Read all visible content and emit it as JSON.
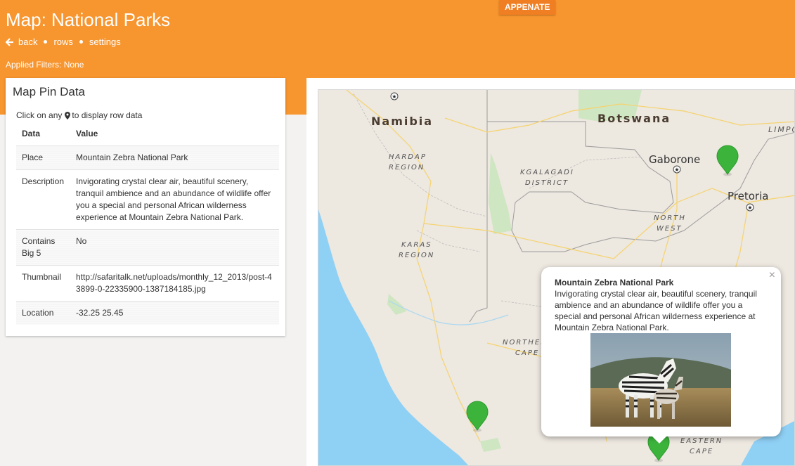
{
  "header": {
    "brand_button": "APPENATE",
    "title": "Map: National Parks",
    "nav": {
      "back": "back",
      "rows": "rows",
      "settings": "settings"
    },
    "filters_label": "Applied Filters: None",
    "background_color": "#f7952e"
  },
  "panel": {
    "title": "Map Pin Data",
    "hint_before": "Click on any",
    "hint_after": "to display row data",
    "hint_icon": "map-marker-icon",
    "columns": {
      "data": "Data",
      "value": "Value"
    },
    "rows": [
      {
        "key": "Place",
        "value": "Mountain Zebra National Park"
      },
      {
        "key": "Description",
        "value": "Invigorating crystal clear air, beautiful scenery, tranquil ambience and an abundance of wildlife offer you a special and personal African wilderness experience at Mountain Zebra National Park."
      },
      {
        "key": "Contains Big 5",
        "value": "No"
      },
      {
        "key": "Thumbnail",
        "value": "http://safaritalk.net/uploads/monthly_12_2013/post-43899-0-22335900-1387184185.jpg"
      },
      {
        "key": "Location",
        "value": "-32.25 25.45"
      }
    ]
  },
  "map": {
    "labels": {
      "namibia": "Namibia",
      "botswana": "Botswana",
      "gaborone": "Gaborone",
      "pretoria": "Pretoria",
      "limpopo": "LIMPO",
      "hardap_1": "HARDAP",
      "hardap_2": "REGION",
      "kgalagadi_1": "KGALAGADI",
      "kgalagadi_2": "DISTRICT",
      "northwest_1": "NORTH",
      "northwest_2": "WEST",
      "karas_1": "KARAS",
      "karas_2": "REGION",
      "ncape_1": "NORTHER",
      "ncape_2": "CAPE",
      "ecape_1": "EASTERN",
      "ecape_2": "CAPE"
    },
    "pin_color": "#3cb43c",
    "popup": {
      "close": "×",
      "title": "Mountain Zebra National Park",
      "description": "Invigorating crystal clear air, beautiful scenery, tranquil ambience and an abundance of wildlife offer you a special and personal African wilderness experience at Mountain Zebra National Park.",
      "thumbnail_alt": "zebras photo"
    }
  }
}
